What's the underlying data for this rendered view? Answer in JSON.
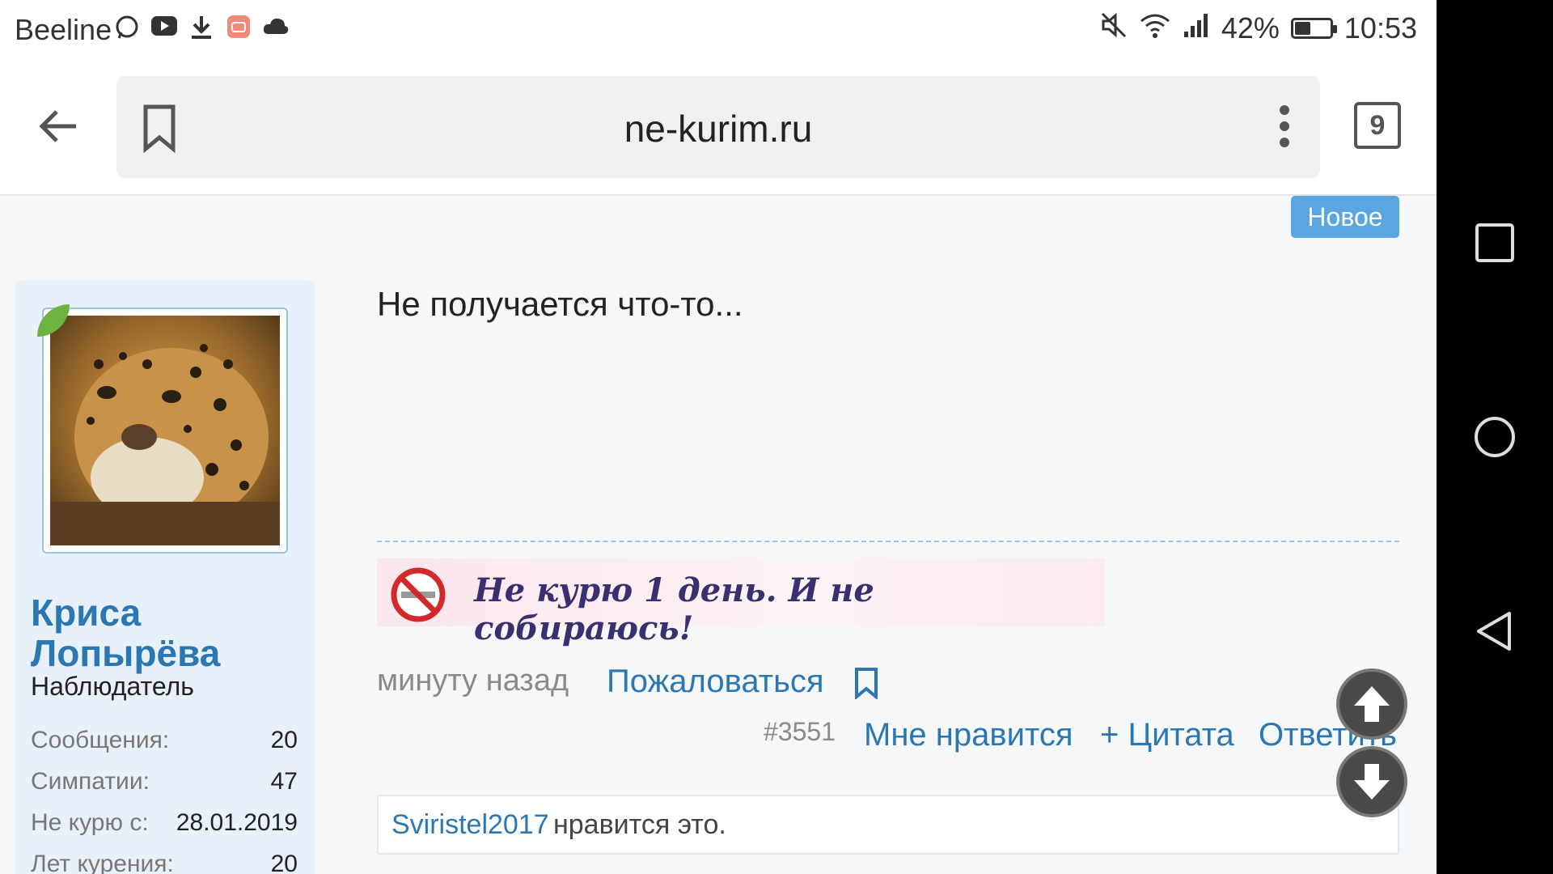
{
  "status": {
    "carrier": "Beeline",
    "battery_text": "42%",
    "battery_level": 0.42,
    "time": "10:53",
    "left_icons": [
      "whatsapp-icon",
      "youtube-icon",
      "download-icon",
      "app-icon",
      "cloud-icon"
    ],
    "right_icons": [
      "mute-icon",
      "wifi-icon",
      "signal-icon"
    ]
  },
  "browser": {
    "url": "ne-kurim.ru",
    "tab_count": "9"
  },
  "post": {
    "badge": "Новое",
    "author": {
      "name": "Криса Лопырёва",
      "title": "Наблюдатель"
    },
    "stats": [
      {
        "label": "Сообщения:",
        "value": "20"
      },
      {
        "label": "Симпатии:",
        "value": "47"
      },
      {
        "label": "Не курю с:",
        "value": "28.01.2019"
      },
      {
        "label": "Лет курения:",
        "value": "20"
      }
    ],
    "text": "Не получается что-то...",
    "signature": "Не курю 1 день. И не собираюсь!",
    "time": "минуту назад",
    "report": "Пожаловаться",
    "number": "#3551",
    "like": "Мне нравится",
    "quote": "+ Цитата",
    "reply": "Ответить",
    "liked_by": "Sviristel2017",
    "liked_text": "нравится это."
  },
  "colors": {
    "link": "#2a77b4",
    "badge": "#5aa6e0",
    "sidebar": "#e8f1f9"
  }
}
